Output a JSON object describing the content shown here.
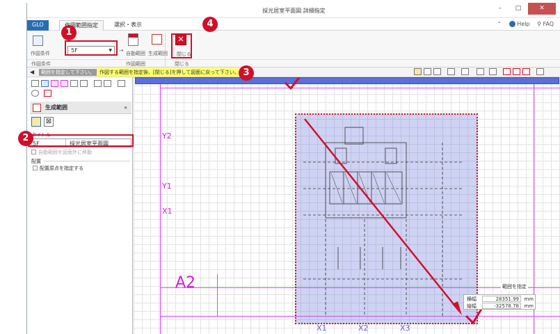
{
  "window": {
    "title": "採光居室平面図 詳細指定",
    "controls": {
      "minimize": "–",
      "maximize": "□",
      "close": "✕"
    }
  },
  "tabs": [
    {
      "label": "GLOBAL",
      "display": "GLO"
    },
    {
      "label": "作図範囲指定"
    },
    {
      "label": "選択・表示"
    }
  ],
  "help": {
    "help_label": "Help",
    "faq_label": "FAQ"
  },
  "ribbon": {
    "draw_condition_label": "作図条件",
    "floor_value": "5F",
    "auto_range_label": "自動範囲",
    "gen_range_label": "生成範囲",
    "close_label": "閉じる",
    "group_draw_condition": "作図条件",
    "group_draw_range": "作図範囲",
    "group_close": "閉じる"
  },
  "message_bar": {
    "chip_text": "範囲を指定して下さい。",
    "message": "作図する範囲を指定後、[閉じる]を押して図面に戻って下さい。"
  },
  "left_panel": {
    "header_title": "生成範囲",
    "title_section_label": "タイトル",
    "title_floor": "5F",
    "title_name": "採光居室平面図",
    "checkbox1_label": "自動範囲を図面外に移動",
    "placement_section_label": "配置",
    "placement_checkbox_label": "配置原点を指定する"
  },
  "canvas": {
    "grid_labels": {
      "y2": "Y2",
      "y1": "Y1",
      "x1_left": "X1",
      "a2": "A2",
      "x1": "X1",
      "x2": "X2",
      "x3": "X3"
    }
  },
  "range_readout": {
    "title": "範囲を指定",
    "width_label": "横幅",
    "width_value": "28351.99",
    "height_label": "縦幅",
    "height_value": "-32578.78",
    "unit": "mm"
  },
  "callouts": [
    "1",
    "2",
    "3",
    "4"
  ],
  "colors": {
    "callout_red": "#d0102a",
    "grid_magenta": "#e040fb",
    "selection_fill": "#6e78dc",
    "tab_blue": "#2b6cb0",
    "message_yellow": "#ffff66"
  }
}
